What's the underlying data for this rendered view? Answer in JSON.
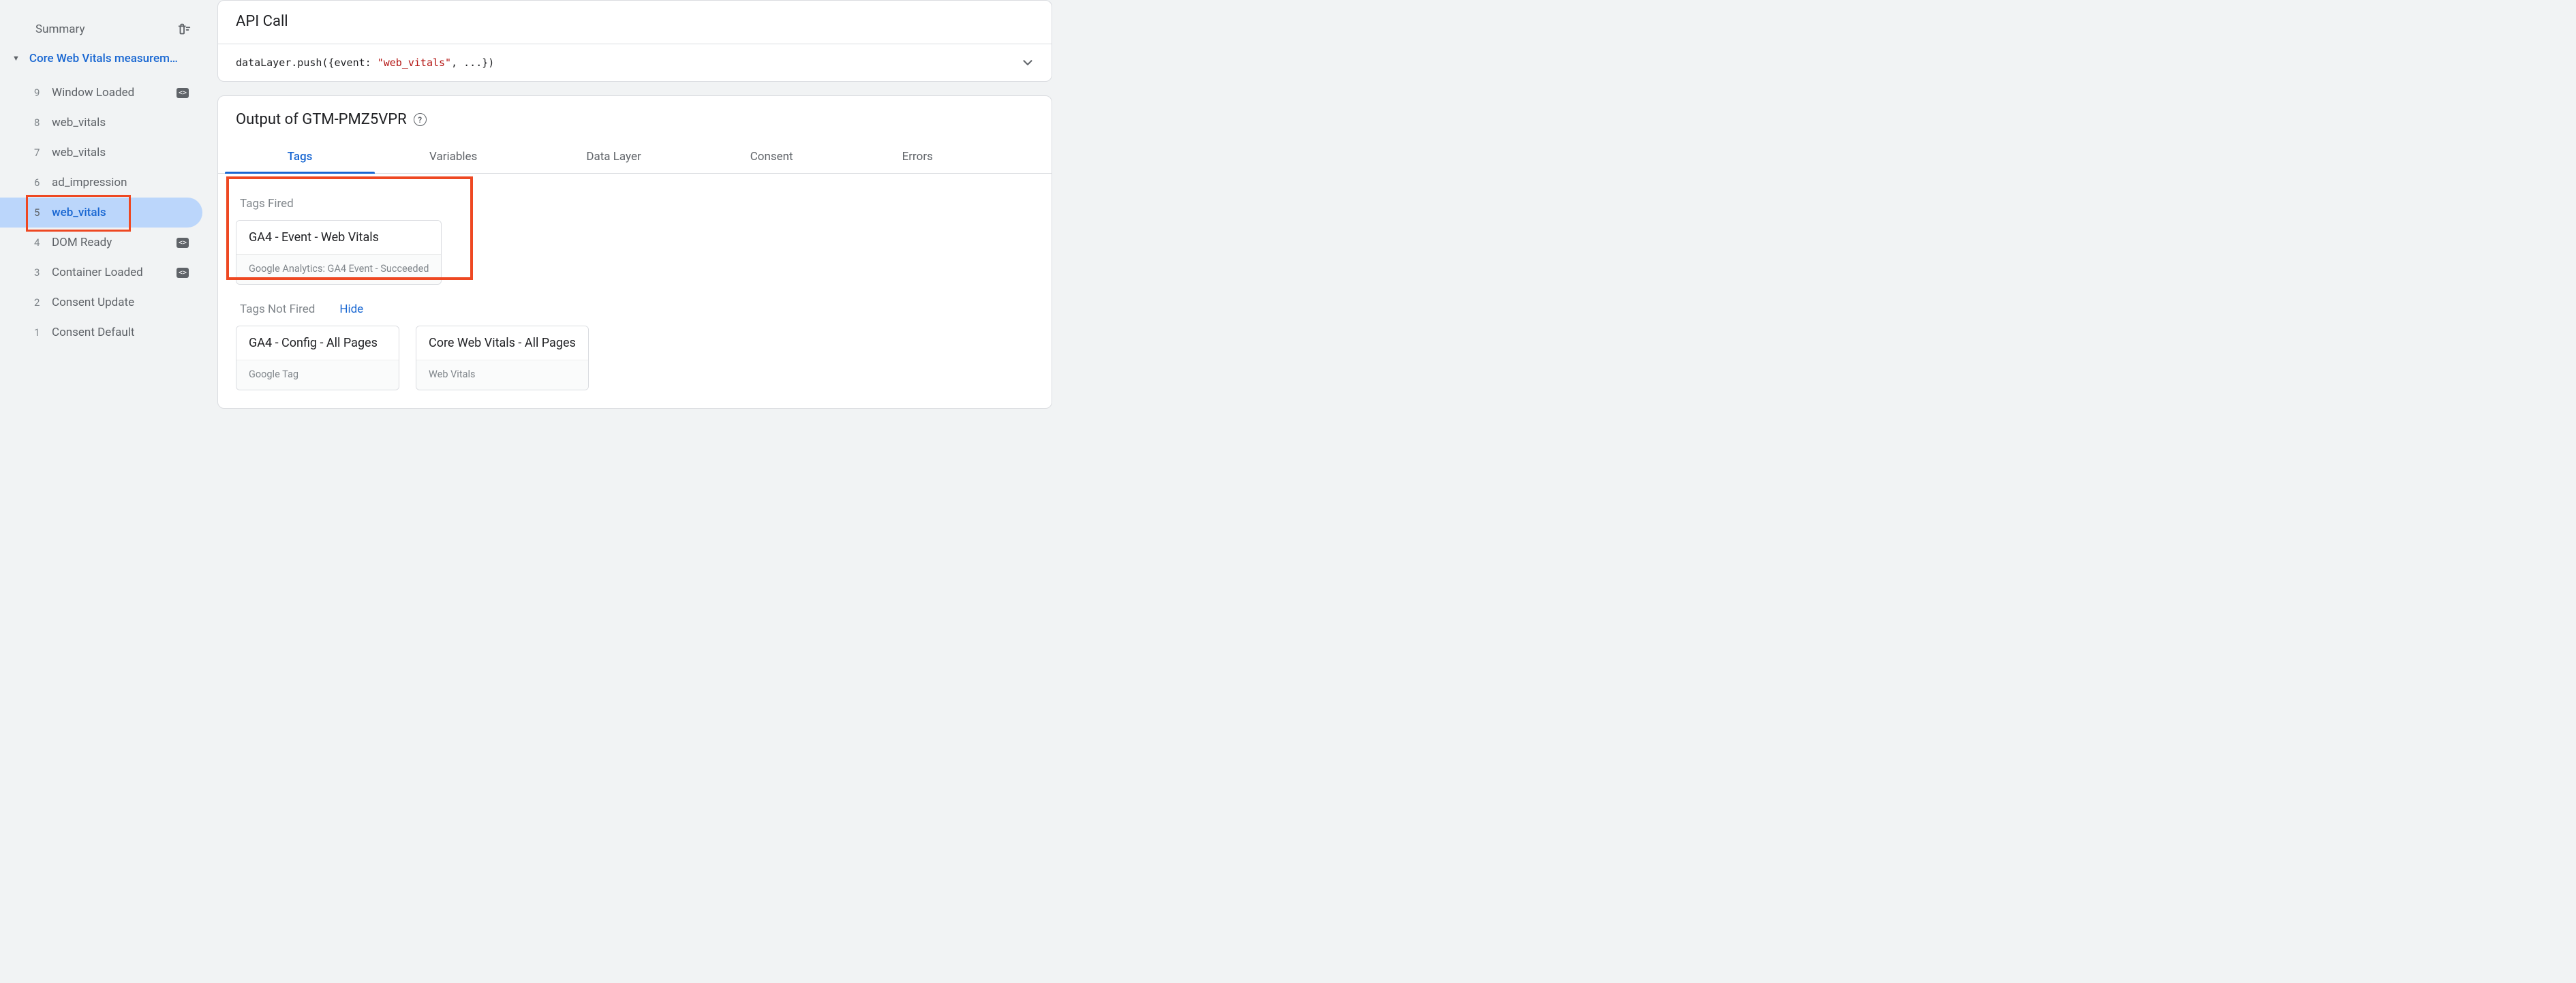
{
  "sidebar": {
    "summary_label": "Summary",
    "tree_title": "Core Web Vitals measurem…",
    "events": [
      {
        "num": "9",
        "label": "Window Loaded",
        "badge": true,
        "selected": false
      },
      {
        "num": "8",
        "label": "web_vitals",
        "badge": false,
        "selected": false
      },
      {
        "num": "7",
        "label": "web_vitals",
        "badge": false,
        "selected": false
      },
      {
        "num": "6",
        "label": "ad_impression",
        "badge": false,
        "selected": false
      },
      {
        "num": "5",
        "label": "web_vitals",
        "badge": false,
        "selected": true
      },
      {
        "num": "4",
        "label": "DOM Ready",
        "badge": true,
        "selected": false
      },
      {
        "num": "3",
        "label": "Container Loaded",
        "badge": true,
        "selected": false
      },
      {
        "num": "2",
        "label": "Consent Update",
        "badge": false,
        "selected": false
      },
      {
        "num": "1",
        "label": "Consent Default",
        "badge": false,
        "selected": false
      }
    ]
  },
  "api_call": {
    "heading": "API Call",
    "code_prefix": "dataLayer.push({event: ",
    "code_string": "\"web_vitals\"",
    "code_suffix": ", ...})"
  },
  "output": {
    "title_prefix": "Output of ",
    "container_id": "GTM-PMZ5VPR",
    "tabs": [
      "Tags",
      "Variables",
      "Data Layer",
      "Consent",
      "Errors"
    ],
    "active_tab": 0,
    "fired_label": "Tags Fired",
    "fired": [
      {
        "title": "GA4 - Event - Web Vitals",
        "sub": "Google Analytics: GA4 Event - Succeeded"
      }
    ],
    "not_fired_label": "Tags Not Fired",
    "hide_label": "Hide",
    "not_fired": [
      {
        "title": "GA4 - Config - All Pages",
        "sub": "Google Tag"
      },
      {
        "title": "Core Web Vitals - All Pages",
        "sub": "Web Vitals"
      }
    ]
  }
}
